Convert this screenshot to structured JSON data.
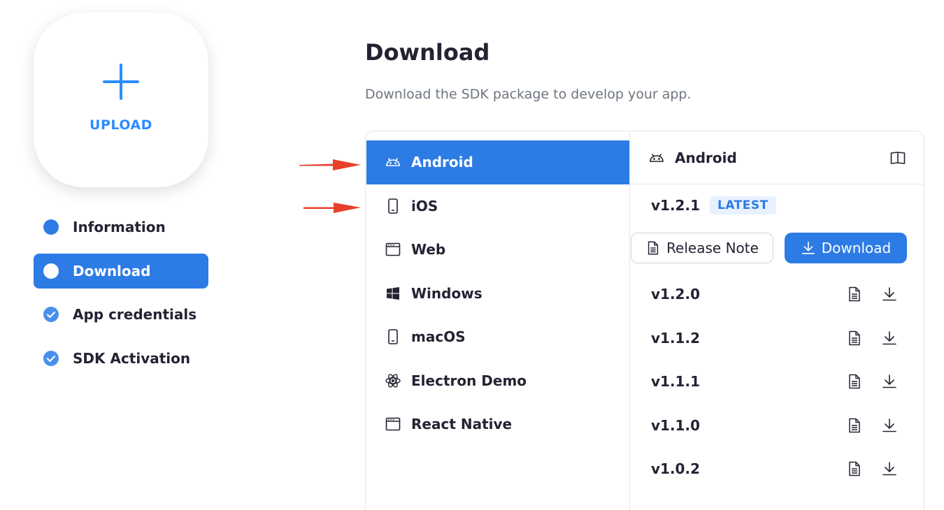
{
  "upload": {
    "label": "UPLOAD"
  },
  "steps": [
    {
      "label": "Information",
      "state": "current-dot"
    },
    {
      "label": "Download",
      "state": "active"
    },
    {
      "label": "App credentials",
      "state": "done"
    },
    {
      "label": "SDK Activation",
      "state": "done"
    }
  ],
  "page": {
    "title": "Download",
    "subtitle": "Download the SDK package to develop your app."
  },
  "platforms": [
    {
      "label": "Android",
      "icon": "android-icon",
      "selected": true
    },
    {
      "label": "iOS",
      "icon": "mobile-icon"
    },
    {
      "label": "Web",
      "icon": "browser-icon"
    },
    {
      "label": "Windows",
      "icon": "windows-icon"
    },
    {
      "label": "macOS",
      "icon": "mobile-icon"
    },
    {
      "label": "Electron Demo",
      "icon": "electron-icon"
    },
    {
      "label": "React Native",
      "icon": "browser-icon"
    }
  ],
  "detail": {
    "title": "Android",
    "latest": {
      "version": "v1.2.1",
      "badge": "LATEST"
    },
    "release_note_label": "Release Note",
    "download_label": "Download",
    "versions": [
      "v1.2.0",
      "v1.1.2",
      "v1.1.1",
      "v1.1.0",
      "v1.0.2"
    ]
  },
  "colors": {
    "primary": "#2D7BE5",
    "upload_accent": "#2D8CFF",
    "arrow": "#E8402A",
    "badge_bg": "#E8F1FE"
  }
}
